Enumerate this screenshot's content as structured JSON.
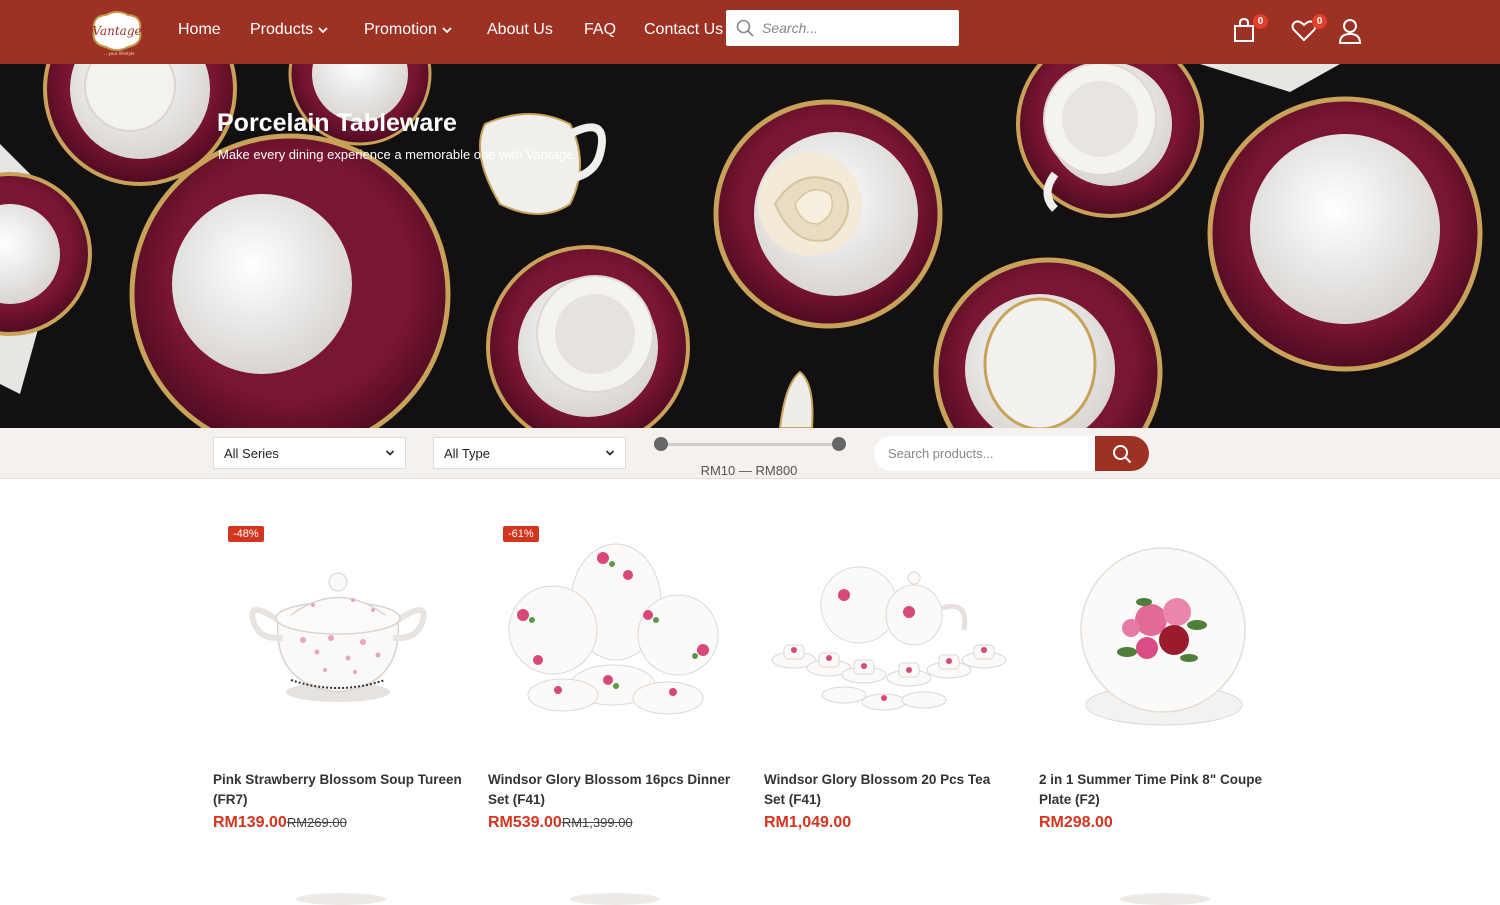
{
  "brand": {
    "logo_text": "Vantage",
    "logo_tagline": "... your lifestyle"
  },
  "nav": {
    "items": [
      {
        "label": "Home"
      },
      {
        "label": "Products",
        "has_dropdown": true
      },
      {
        "label": "Promotion",
        "has_dropdown": true
      },
      {
        "label": "About Us"
      },
      {
        "label": "FAQ"
      },
      {
        "label": "Contact Us"
      }
    ],
    "search_placeholder": "Search...",
    "cart_count": "0",
    "wishlist_count": "0",
    "icons": [
      "search-icon",
      "cart-icon",
      "heart-icon",
      "user-icon"
    ]
  },
  "hero": {
    "title": "Porcelain Tableware",
    "subtitle": "Make every dining experience a memorable one with Vantage."
  },
  "filters": {
    "series": {
      "selected": "All Series"
    },
    "type": {
      "selected": "All Type"
    },
    "price_range": {
      "min": 10,
      "max": 800,
      "label": "RM10 — RM800"
    },
    "search_placeholder": "Search products..."
  },
  "products": [
    {
      "badge": "-48%",
      "title": "Pink Strawberry Blossom Soup Tureen (FR7)",
      "price": "RM139.00",
      "old_price": "RM269.00"
    },
    {
      "badge": "-61%",
      "title": "Windsor Glory Blossom 16pcs Dinner Set (F41)",
      "price": "RM539.00",
      "old_price": "RM1,399.00"
    },
    {
      "badge": "",
      "title": "Windsor Glory Blossom 20 Pcs Tea Set (F41)",
      "price": "RM1,049.00",
      "old_price": ""
    },
    {
      "badge": "",
      "title": "2 in 1 Summer Time Pink 8\" Coupe Plate (F2)",
      "price": "RM298.00",
      "old_price": ""
    }
  ],
  "colors": {
    "brand": "#9d3124",
    "sale": "#d3351f",
    "hero_plate_rim": "#6e1230"
  }
}
